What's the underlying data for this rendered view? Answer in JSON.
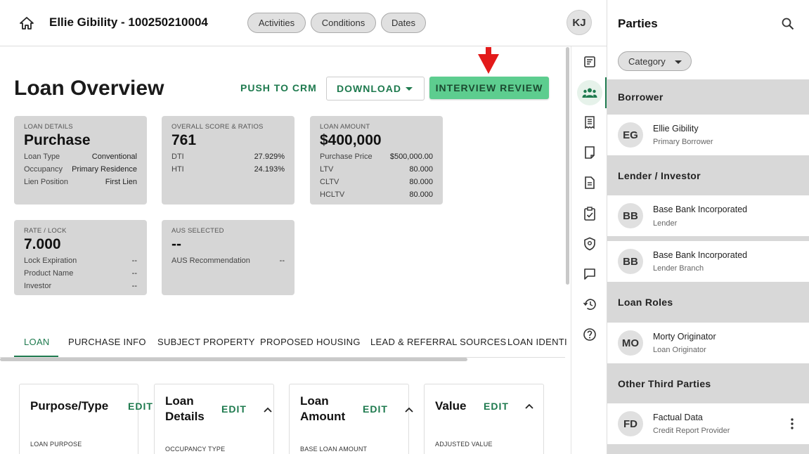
{
  "header": {
    "title": "Ellie Gibility - 100250210004",
    "chips": [
      "Activities",
      "Conditions",
      "Dates"
    ],
    "user_initials": "KJ"
  },
  "main": {
    "page_title": "Loan Overview",
    "push_to_crm": "PUSH TO CRM",
    "download": "DOWNLOAD",
    "interview_review": "INTERVIEW REVIEW",
    "cards": {
      "loan_details": {
        "caption": "LOAN DETAILS",
        "value": "Purchase",
        "rows": [
          {
            "label": "Loan Type",
            "value": "Conventional"
          },
          {
            "label": "Occupancy",
            "value": "Primary Residence"
          },
          {
            "label": "Lien Position",
            "value": "First Lien"
          }
        ]
      },
      "score": {
        "caption": "OVERALL SCORE & RATIOS",
        "value": "761",
        "rows": [
          {
            "label": "DTI",
            "value": "27.929%"
          },
          {
            "label": "HTI",
            "value": "24.193%"
          }
        ]
      },
      "loan_amount": {
        "caption": "LOAN AMOUNT",
        "value": "$400,000",
        "rows": [
          {
            "label": "Purchase Price",
            "value": "$500,000.00"
          },
          {
            "label": "LTV",
            "value": "80.000"
          },
          {
            "label": "CLTV",
            "value": "80.000"
          },
          {
            "label": "HCLTV",
            "value": "80.000"
          }
        ]
      },
      "rate_lock": {
        "caption": "RATE / LOCK",
        "value": "7.000",
        "rows": [
          {
            "label": "Lock Expiration",
            "value": "--"
          },
          {
            "label": "Product Name",
            "value": "--"
          },
          {
            "label": "Investor",
            "value": "--"
          }
        ]
      },
      "aus": {
        "caption": "AUS SELECTED",
        "value": "--",
        "rows": [
          {
            "label": "AUS Recommendation",
            "value": "--"
          }
        ]
      }
    },
    "tabs": [
      "LOAN",
      "PURCHASE INFO",
      "SUBJECT PROPERTY",
      "PROPOSED HOUSING",
      "LEAD & REFERRAL SOURCES",
      "LOAN IDENTI"
    ],
    "sections": [
      {
        "title": "Purpose/Type",
        "edit": "EDIT",
        "field": "LOAN PURPOSE"
      },
      {
        "title_l1": "Loan",
        "title_l2": "Details",
        "edit": "EDIT",
        "field": "OCCUPANCY TYPE"
      },
      {
        "title_l1": "Loan",
        "title_l2": "Amount",
        "edit": "EDIT",
        "field": "BASE LOAN AMOUNT"
      },
      {
        "title": "Value",
        "edit": "EDIT",
        "field": "ADJUSTED VALUE"
      }
    ]
  },
  "rail": {
    "icons": [
      "summary-icon",
      "people-icon",
      "receipt-icon",
      "document-corner-icon",
      "document-icon",
      "clipboard-check-icon",
      "shield-icon",
      "chat-icon",
      "history-icon",
      "help-icon"
    ]
  },
  "panel": {
    "title": "Parties",
    "category": "Category",
    "groups": [
      {
        "name": "Borrower",
        "parties": [
          {
            "initials": "EG",
            "name": "Ellie Gibility",
            "role": "Primary Borrower"
          }
        ]
      },
      {
        "name": "Lender / Investor",
        "parties": [
          {
            "initials": "BB",
            "name": "Base Bank Incorporated",
            "role": "Lender"
          },
          {
            "initials": "BB",
            "name": "Base Bank Incorporated",
            "role": "Lender Branch"
          }
        ]
      },
      {
        "name": "Loan Roles",
        "parties": [
          {
            "initials": "MO",
            "name": "Morty Originator",
            "role": "Loan Originator"
          }
        ]
      },
      {
        "name": "Other Third Parties",
        "parties": [
          {
            "initials": "FD",
            "name": "Factual Data",
            "role": "Credit Report Provider"
          }
        ]
      }
    ]
  },
  "colors": {
    "accent": "#1e7a4e",
    "interview_button": "#5dcd8f",
    "card_bg": "#d6d6d6",
    "arrow": "#e31a1a"
  }
}
